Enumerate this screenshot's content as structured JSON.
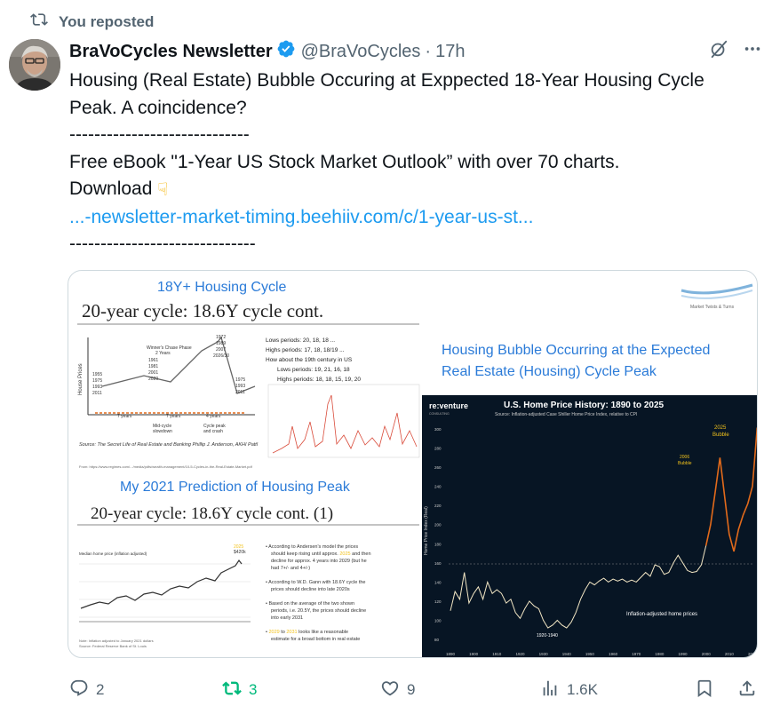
{
  "repost": {
    "label": "You reposted"
  },
  "author": {
    "name": "BraVoCycles Newsletter",
    "handle": "@BraVoCycles",
    "separator": "·",
    "time": "17h"
  },
  "tweet": {
    "line1": "Housing (Real Estate) Bubble Occuring at Exppected 18-Year Housing Cycle",
    "line2": "Peak. A coincidence?",
    "divider1": "-----------------------------",
    "line3": "Free eBook \"1-Year US Stock Market Outlook” with over 70 charts.",
    "line4": "Download",
    "link": "...-newsletter-market-timing.beehiiv.com/c/1-year-us-st...",
    "divider2": "------------------------------"
  },
  "media": {
    "left_title": "18Y+ Housing Cycle",
    "left_subtitle": "20-year cycle: 18.6Y cycle cont.",
    "brand_text": "Market Twists & Turns",
    "chart1_labels": [
      "Winner's Chase Phase",
      "2 Years",
      "1972",
      "1989",
      "2007",
      "2026/30",
      "1961",
      "1981",
      "2001",
      "2020",
      "1955",
      "1975",
      "1993",
      "2011",
      "1975",
      "1993",
      "2011"
    ],
    "periods_label": [
      "7 years",
      "7 years",
      "4 years"
    ],
    "sub_labels": [
      "Mid-cycle slowdown",
      "Cycle peak and crash"
    ],
    "bullet_list": [
      "Lows periods: 20, 18, 18 ...",
      "Highs periods: 17, 18, 18/19 ...",
      "How about the 19th century in US",
      "Lows periods: 19, 21, 16, 18",
      "Highs periods: 18, 18, 15, 19, 20"
    ],
    "source_note": "Source: The Secret Life of Real Estate and Banking Phillip J. Anderson, AKHI Pattl",
    "url_note": "From: https://www.regimes.com/.../media/pdfs/wealth-management/10-5-Cycles-in-the-Real-Estate-Market.pdf",
    "prediction_title": "My 2021 Prediction of Housing Peak",
    "prediction_subtitle": "20-year cycle: 18.6Y cycle cont. (1)",
    "prediction_chart_title": "Median home price (inflation adjusted)",
    "prediction_bullets": [
      "According to Andersen's model the prices should keep rising until approx. 2025 and then decline for approx. 4 years into 2029 (but he had 7+/- and 4+/-)",
      "According to W.D. Gann with 18.6Y cycle the prices should decline into late 2020s",
      "Based on the average of the two shown periods, i.e. 20.5Y, the prices should decline into early 2031",
      "2029 to 2031 looks like a reasonable estimate for a broad bottom in real estate"
    ],
    "right_title1": "Housing Bubble Occurring at the Expected",
    "right_title2": "Real Estate (Housing) Cycle Peak",
    "hp_brand": "re:venture",
    "hp_brand_sub": "CONSULTING",
    "hp_title": "U.S. Home Price History: 1890 to 2025",
    "hp_subtitle": "Source: Inflation-adjusted Case Shiller Home Price Index, relative to CPI",
    "hp_ylabel": "Home Price Index (Real)",
    "hp_label_2025": "2025",
    "hp_label_bubble": "Bubble",
    "hp_label_2006": "2006",
    "hp_label_bubble2": "Bubble",
    "hp_label_1920": "1920-1940",
    "hp_legend": "Inflation-adjusted home prices",
    "hp_yticks": [
      "300",
      "280",
      "260",
      "240",
      "220",
      "200",
      "180",
      "160",
      "140",
      "120",
      "100",
      "80"
    ],
    "hp_xticks": [
      "1890",
      "1900",
      "1910",
      "1920",
      "1930",
      "1940",
      "1950",
      "1960",
      "1970",
      "1980",
      "1990",
      "2000",
      "2010",
      "2020"
    ],
    "colors": {
      "title_blue": "#2b7bd8",
      "chart_bg": "#071524",
      "line": "#f2e6c4",
      "bubble": "#e26a1b",
      "label_yellow": "#f2c21b"
    }
  },
  "actions": {
    "replies": "2",
    "reposts": "3",
    "likes": "9",
    "views": "1.6K"
  }
}
